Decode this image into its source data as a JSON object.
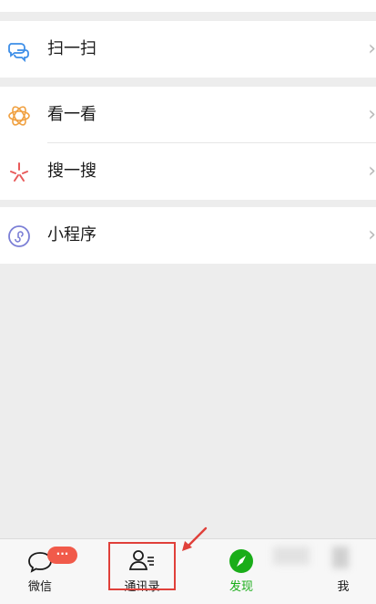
{
  "menu": {
    "group1": [
      {
        "label": "扫一扫",
        "icon": "scan-icon"
      }
    ],
    "group2": [
      {
        "label": "看一看",
        "icon": "top-stories-icon"
      },
      {
        "label": "搜一搜",
        "icon": "search-icon"
      }
    ],
    "group3": [
      {
        "label": "小程序",
        "icon": "mini-programs-icon"
      }
    ]
  },
  "tabbar": {
    "tabs": [
      {
        "label": "微信",
        "icon": "chat-bubble-icon"
      },
      {
        "label": "通讯录",
        "icon": "contacts-icon"
      },
      {
        "label": "发现",
        "icon": "compass-icon"
      },
      {
        "label": "我",
        "icon": "user-icon"
      }
    ],
    "badge": "···"
  },
  "colors": {
    "accent_green": "#1aad19",
    "badge_red": "#f15a4a",
    "highlight_red": "#e0403a",
    "background": "#ededed"
  }
}
